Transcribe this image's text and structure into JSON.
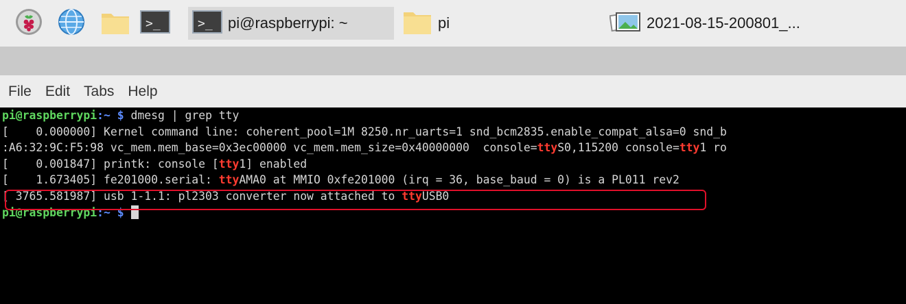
{
  "taskbar": {
    "launchers": [
      {
        "icon": "raspberry-menu-icon"
      },
      {
        "icon": "web-browser-icon"
      },
      {
        "icon": "file-manager-icon"
      },
      {
        "icon": "terminal-icon"
      }
    ],
    "tasks": [
      {
        "icon": "terminal-icon",
        "label": "pi@raspberrypi: ~",
        "active": true
      },
      {
        "icon": "folder-icon",
        "label": "pi",
        "active": false
      },
      {
        "icon": "image-file-icon",
        "label": "2021-08-15-200801_...",
        "active": false
      }
    ]
  },
  "menu": {
    "file": "File",
    "edit": "Edit",
    "tabs": "Tabs",
    "help": "Help"
  },
  "terminal": {
    "prompt_user": "pi@raspberrypi",
    "prompt_path": ":~",
    "prompt_symbol": " $",
    "command": " dmesg | grep tty",
    "lines": [
      {
        "pre": "[    0.000000] Kernel command line: coherent_pool=1M 8250.nr_uarts=1 snd_bcm2835.enable_compat_alsa=0 snd_b",
        "hl": "",
        "post": ""
      },
      {
        "pre": ":A6:32:9C:F5:98 vc_mem.mem_base=0x3ec00000 vc_mem.mem_size=0x40000000  console=",
        "hl": "tty",
        "post": "S0,115200 console=",
        "hl2": "tty",
        "post2": "1 ro"
      },
      {
        "pre": "[    0.001847] printk: console [",
        "hl": "tty",
        "post": "1] enabled"
      },
      {
        "pre": "[    1.673405] fe201000.serial: ",
        "hl": "tty",
        "post": "AMA0 at MMIO 0xfe201000 (irq = 36, base_baud = 0) is a PL011 rev2"
      },
      {
        "pre": "[ 3765.581987] usb 1-1.1: pl2303 converter now attached to ",
        "hl": "tty",
        "post": "USB0"
      }
    ]
  },
  "colors": {
    "prompt_user": "#5fd75f",
    "prompt_path": "#5c8cff",
    "match_highlight": "#ff3b30",
    "annotation_box": "#e0102a"
  }
}
